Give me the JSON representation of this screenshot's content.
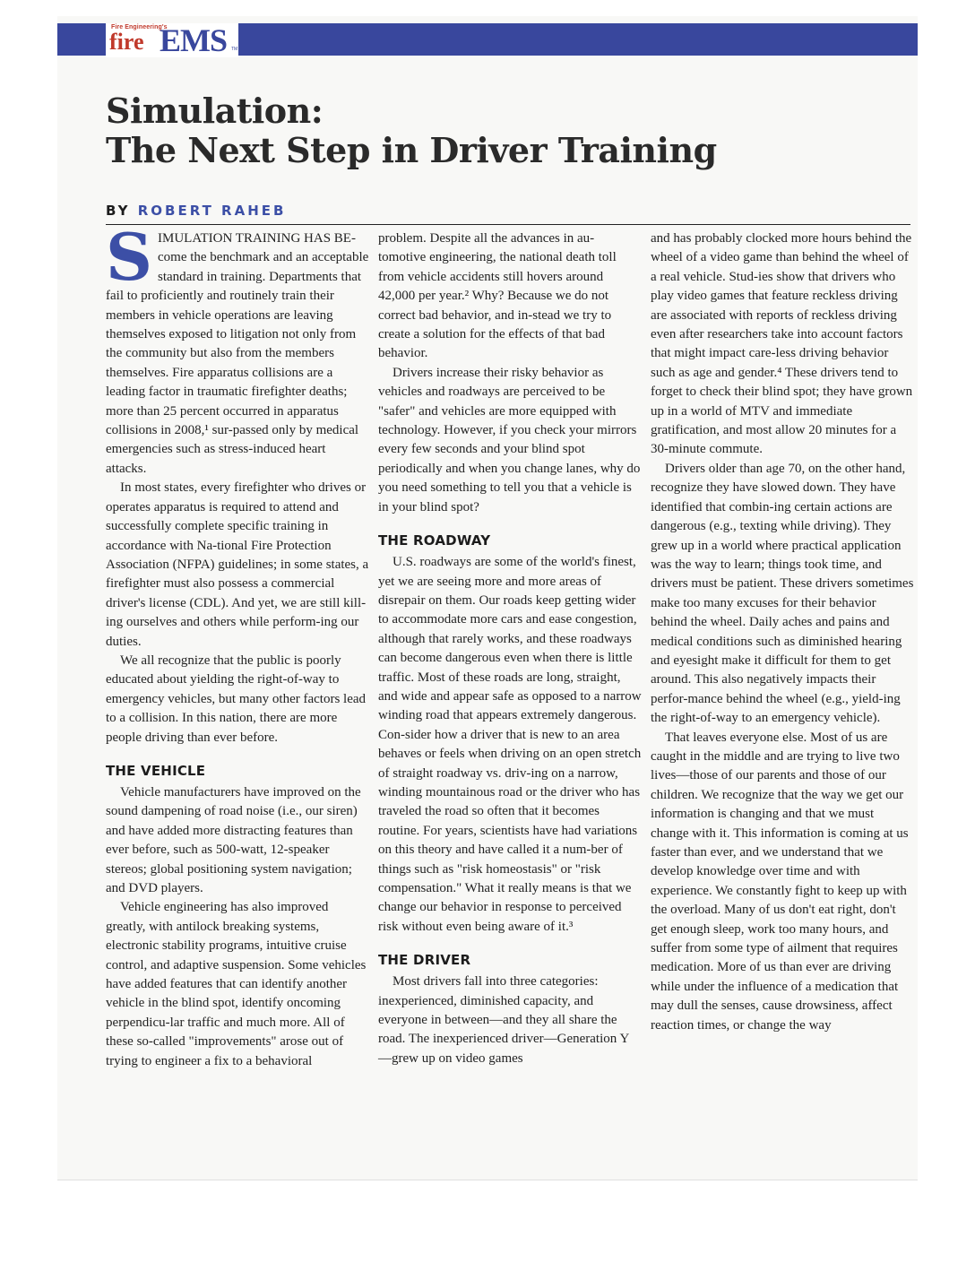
{
  "header": {
    "logo_small": "Fire Engineering's",
    "logo_fire": "fire",
    "logo_ems": "EMS",
    "logo_tm": "TM",
    "banner_color": "#39479d"
  },
  "article": {
    "title_line1": "Simulation:",
    "title_line2": "The Next Step in Driver Training",
    "byline_label": "BY",
    "byline_author": "ROBERT RAHEB",
    "dropcap": "S",
    "lead_caps": "IMULATION TRAINING HAS BE-come the benchmark and an acceptable standard in training.",
    "p1_rest": " Departments that fail to proficiently and routinely train their members in vehicle operations are leaving themselves exposed to litigation not only from the community but also from the members themselves. Fire apparatus collisions are a leading factor in traumatic firefighter deaths; more than 25 percent occurred in apparatus collisions in 2008,¹ sur-passed only by medical emergencies such as stress-induced heart attacks.",
    "p2": "In most states, every firefighter who drives or operates apparatus is required to attend and successfully complete specific training in accordance with Na-tional Fire Protection Association (NFPA) guidelines; in some states, a firefighter must also possess a commercial driver's license (CDL). And yet, we are still kill-ing ourselves and others while perform-ing our duties.",
    "p3": "We all recognize that the public is poorly educated about yielding the right-of-way to emergency vehicles, but many other factors lead to a collision. In this nation, there are more people driving than ever before.",
    "h_vehicle": "THE VEHICLE",
    "p4": "Vehicle manufacturers have improved on the sound dampening of road noise (i.e., our siren) and have added more distracting features than ever before, such as 500-watt, 12-speaker stereos; global positioning system navigation; and DVD players.",
    "p5": "Vehicle engineering has also improved greatly, with antilock breaking systems, electronic stability programs, intuitive cruise control, and adaptive suspension. Some vehicles have added features that can identify another vehicle in the blind spot, identify oncoming perpendicu-lar traffic and much more. All of these so-called \"improvements\" arose out of trying to engineer a fix to a behavioral",
    "p6": "problem. Despite all the advances in au-tomotive engineering, the national death toll from vehicle accidents still hovers around 42,000 per year.² Why? Because we do not correct bad behavior, and in-stead we try to create a solution for the effects of that bad behavior.",
    "p7": "Drivers increase their risky behavior as vehicles and roadways are perceived to be \"safer\" and vehicles are more equipped with technology. However, if you check your mirrors every few seconds and your blind spot periodically and when you change lanes, why do you need something to tell you that a vehicle is in your blind spot?",
    "h_roadway": "THE ROADWAY",
    "p8": "U.S. roadways are some of the world's finest, yet we are seeing more and more areas of disrepair on them. Our roads keep getting wider to accommodate more cars and ease congestion, although that rarely works, and these roadways can become dangerous even when there is little traffic. Most of these roads are long, straight, and wide and appear safe as opposed to a narrow winding road that appears extremely dangerous. Con-sider how a driver that is new to an area behaves or feels when driving on an open stretch of straight roadway vs. driv-ing on a narrow, winding mountainous road or the driver who has traveled the road so often that it becomes routine. For years, scientists have had variations on this theory and have called it a num-ber of things such as \"risk homeostasis\" or \"risk compensation.\" What it really means is that we change our behavior in response to perceived risk without even being aware of it.³",
    "h_driver": "THE DRIVER",
    "p9": "Most drivers fall into three categories: inexperienced, diminished capacity, and everyone in between—and they all share the road. The inexperienced driver—Generation Y—grew up on video games",
    "p10": "and has probably clocked more hours behind the wheel of a video game than behind the wheel of a real vehicle. Stud-ies show that drivers who play video games that feature reckless driving are associated with reports of reckless driving even after researchers take into account factors that might impact care-less driving behavior such as age and gender.⁴ These drivers tend to forget to check their blind spot; they have grown up in a world of MTV and immediate gratification, and most allow 20 minutes for a 30-minute commute.",
    "p11": "Drivers older than age 70, on the other hand, recognize they have slowed down. They have identified that combin-ing certain actions are dangerous (e.g., texting while driving). They grew up in a world where practical application was the way to learn; things took time, and drivers must be patient. These drivers sometimes make too many excuses for their behavior behind the wheel. Daily aches and pains and medical conditions such as diminished hearing and eyesight make it difficult for them to get around. This also negatively impacts their perfor-mance behind the wheel (e.g., yield-ing the right-of-way to an emergency vehicle).",
    "p12": "That leaves everyone else. Most of us are caught in the middle and are trying to live two lives—those of our parents and those of our children. We recognize that the way we get our information is changing and that we must change with it. This information is coming at us faster than ever, and we understand that we develop knowledge over time and with experience. We constantly fight to keep up with the overload. Many of us don't eat right, don't get enough sleep, work too many hours, and suffer from some type of ailment that requires medication. More of us than ever are driving while under the influence of a medication that may dull the senses, cause drowsiness, affect reaction times, or change the way"
  }
}
